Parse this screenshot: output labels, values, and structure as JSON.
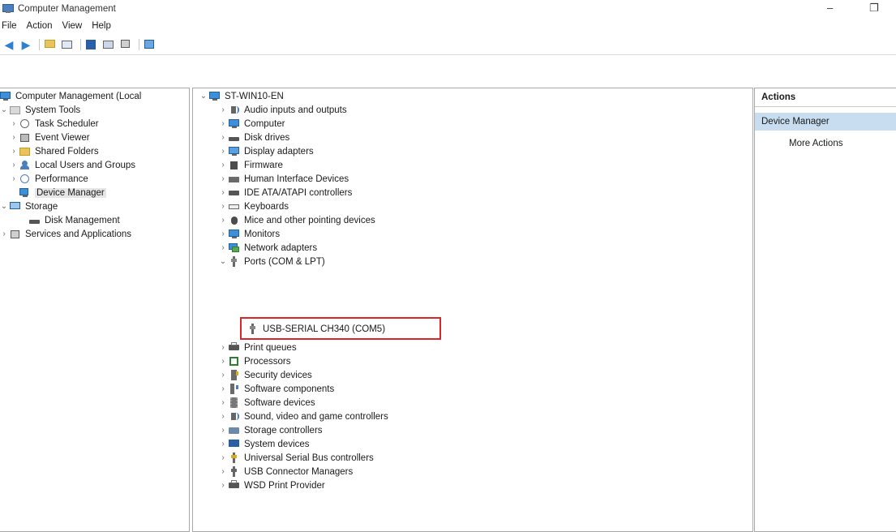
{
  "window": {
    "title": "Computer Management",
    "controls": [
      "–",
      "❐"
    ]
  },
  "menu": [
    "File",
    "Action",
    "View",
    "Help"
  ],
  "toolbar": {
    "icons": [
      "back-arrow-icon",
      "forward-arrow-icon",
      "folder-up-icon",
      "console-tree-icon",
      "properties-icon",
      "help-icon",
      "export-list-icon",
      "show-hide-icon"
    ]
  },
  "left_tree": [
    {
      "label": "Computer Management (Local",
      "icon": "computer-management-icon",
      "expander": ""
    },
    {
      "label": "System Tools",
      "icon": "system-tools-icon",
      "expander": "⌄"
    },
    {
      "label": "Task Scheduler",
      "icon": "task-scheduler-icon",
      "expander": "›"
    },
    {
      "label": "Event Viewer",
      "icon": "event-viewer-icon",
      "expander": "›"
    },
    {
      "label": "Shared Folders",
      "icon": "shared-folders-icon",
      "expander": "›"
    },
    {
      "label": "Local Users and Groups",
      "icon": "local-users-icon",
      "expander": "›"
    },
    {
      "label": "Performance",
      "icon": "performance-icon",
      "expander": "›"
    },
    {
      "label": "Device Manager",
      "icon": "device-manager-icon",
      "expander": ""
    },
    {
      "label": "Storage",
      "icon": "storage-icon",
      "expander": "⌄"
    },
    {
      "label": "Disk Management",
      "icon": "disk-management-icon",
      "expander": ""
    },
    {
      "label": "Services and Applications",
      "icon": "services-icon",
      "expander": "›"
    }
  ],
  "device_tree": {
    "root": "ST-WIN10-EN",
    "categories": [
      {
        "label": "Audio inputs and outputs",
        "icon": "audio-icon"
      },
      {
        "label": "Computer",
        "icon": "computer-icon"
      },
      {
        "label": "Disk drives",
        "icon": "disk-drive-icon"
      },
      {
        "label": "Display adapters",
        "icon": "display-adapter-icon"
      },
      {
        "label": "Firmware",
        "icon": "firmware-icon"
      },
      {
        "label": "Human Interface Devices",
        "icon": "hid-icon"
      },
      {
        "label": "IDE ATA/ATAPI controllers",
        "icon": "ide-controller-icon"
      },
      {
        "label": "Keyboards",
        "icon": "keyboard-icon"
      },
      {
        "label": "Mice and other pointing devices",
        "icon": "mouse-icon"
      },
      {
        "label": "Monitors",
        "icon": "monitor-icon"
      },
      {
        "label": "Network adapters",
        "icon": "network-adapter-icon"
      },
      {
        "label": "Ports (COM & LPT)",
        "icon": "port-icon",
        "expanded": true
      },
      {
        "label": "USB-SERIAL CH340 (COM5)",
        "icon": "usb-serial-icon",
        "child": true
      },
      {
        "label": "Print queues",
        "icon": "print-queue-icon"
      },
      {
        "label": "Processors",
        "icon": "processor-icon"
      },
      {
        "label": "Security devices",
        "icon": "security-device-icon"
      },
      {
        "label": "Software components",
        "icon": "software-component-icon"
      },
      {
        "label": "Software devices",
        "icon": "software-device-icon"
      },
      {
        "label": "Sound, video and game controllers",
        "icon": "sound-icon"
      },
      {
        "label": "Storage controllers",
        "icon": "storage-controller-icon"
      },
      {
        "label": "System devices",
        "icon": "system-device-icon"
      },
      {
        "label": "Universal Serial Bus controllers",
        "icon": "usb-controller-icon"
      },
      {
        "label": "USB Connector Managers",
        "icon": "usb-connector-icon"
      },
      {
        "label": "WSD Print Provider",
        "icon": "wsd-print-icon"
      }
    ]
  },
  "actions": {
    "header": "Actions",
    "section": "Device Manager",
    "more": "More Actions"
  },
  "colors": {
    "highlight_box": "#d9262b",
    "actions_selected": "#c8ddf0"
  }
}
